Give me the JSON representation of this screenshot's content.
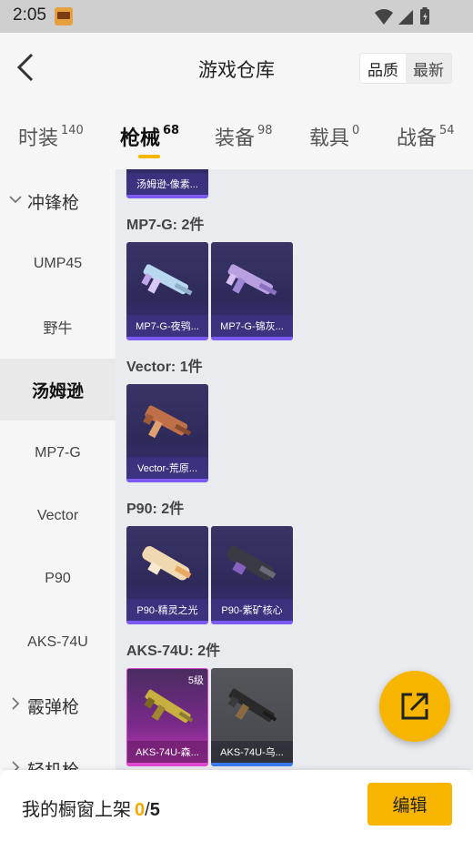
{
  "status_bar": {
    "time": "2:05",
    "icons": [
      "app-icon",
      "wifi-icon",
      "signal-icon",
      "battery-icon"
    ]
  },
  "header": {
    "title": "游戏仓库",
    "back_icon": "chevron-left-icon",
    "sort_options": [
      "品质",
      "最新"
    ],
    "sort_selected": "品质"
  },
  "tabs": [
    {
      "label": "时装",
      "count": "140"
    },
    {
      "label": "枪械",
      "count": "68",
      "active": true
    },
    {
      "label": "装备",
      "count": "98"
    },
    {
      "label": "载具",
      "count": "0"
    },
    {
      "label": "战备",
      "count": "54"
    }
  ],
  "sidebar": {
    "groups": [
      {
        "label": "冲锋枪",
        "expanded": true
      },
      {
        "label": "霰弹枪",
        "expanded": false
      },
      {
        "label": "轻机枪",
        "expanded": false
      }
    ],
    "items": [
      "UMP45",
      "野牛",
      "汤姆逊",
      "MP7-G",
      "Vector",
      "P90",
      "AKS-74U"
    ],
    "selected": "汤姆逊"
  },
  "main": {
    "partial_card": {
      "name": "汤姆逊-像素..."
    },
    "sections": [
      {
        "title": "MP7-G: 2件",
        "cards": [
          {
            "name": "MP7-G-夜鸮..."
          },
          {
            "name": "MP7-G-锦灰..."
          }
        ]
      },
      {
        "title": "Vector: 1件",
        "cards": [
          {
            "name": "Vector-荒原..."
          }
        ]
      },
      {
        "title": "P90: 2件",
        "cards": [
          {
            "name": "P90-精灵之光"
          },
          {
            "name": "P90-紫矿核心"
          }
        ]
      },
      {
        "title": "AKS-74U: 2件",
        "cards": [
          {
            "name": "AKS-74U-森...",
            "level": "5级"
          },
          {
            "name": "AKS-74U-乌..."
          }
        ]
      }
    ]
  },
  "fab": {
    "icon": "share-icon"
  },
  "bottom_bar": {
    "label": "我的橱窗上架",
    "count": "0",
    "separator": "/",
    "max": "5",
    "edit_label": "编辑"
  },
  "colors": {
    "accent": "#f7b500",
    "card_purple": "#2d2a5a",
    "card_border_purple": "#7c5cf0",
    "card_pink": "#c03ab0"
  }
}
